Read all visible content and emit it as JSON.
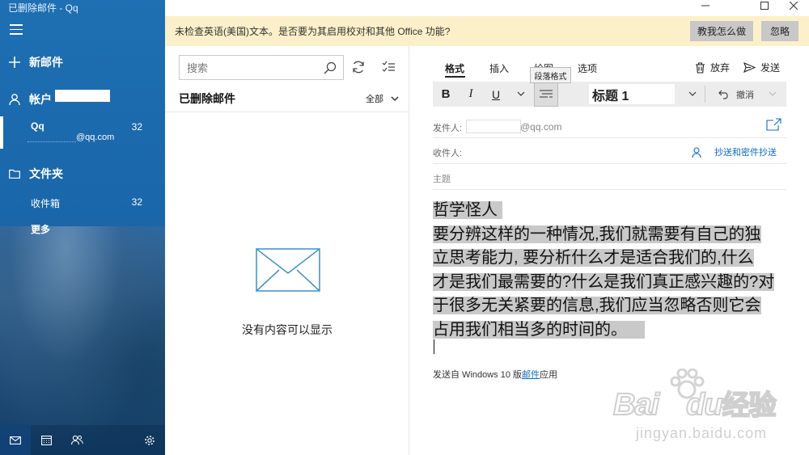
{
  "window": {
    "title": "已删除邮件 - Qq"
  },
  "sidebar": {
    "new_mail": "新邮件",
    "accounts_label": "帐户",
    "account": {
      "name": "Qq",
      "count": "32",
      "email_suffix": "@qq.com"
    },
    "folders_label": "文件夹",
    "inbox": {
      "label": "收件箱",
      "count": "32"
    },
    "more": "更多"
  },
  "infobar": {
    "message": "未检查英语(美国)文本。是否要为其启用校对和其他 Office 功能?",
    "teach_button": "教我怎么做",
    "ignore_button": "忽略"
  },
  "list": {
    "search_placeholder": "搜索",
    "folder_title": "已删除邮件",
    "filter_label": "全部",
    "empty_message": "没有内容可以显示"
  },
  "compose": {
    "tabs": [
      "格式",
      "插入",
      "绘图",
      "选项"
    ],
    "discard_label": "放弃",
    "send_label": "发送",
    "bold": "B",
    "italic": "I",
    "underline": "U",
    "style_value": "标题 1",
    "undo_label": "撤消",
    "tooltip": "段落格式",
    "from_label": "发件人:",
    "from_suffix": "@qq.com",
    "to_label": "收件人:",
    "cc_link": "抄送和密件抄送",
    "subject_placeholder": "主题",
    "body_heading": "哲学怪人",
    "body_lines": [
      "要分辨这样的一种情况,我们就需要有自己的独",
      "立思考能力, 要分析什么才是适合我们的,什么",
      "才是我们最需要的?什么是我们真正感兴趣的?对",
      "于很多无关紧要的信息,我们应当忽略否则它会",
      "占用我们相当多的时间的。"
    ],
    "signature_prefix": "发送自 Windows 10 版",
    "signature_link": "邮件",
    "signature_suffix": "应用"
  },
  "watermark": {
    "brand": "Bai",
    "brand_suffix": "du",
    "cn": "经验",
    "url": "jingyan.baidu.com"
  },
  "colors": {
    "sidebar_blue": "#1e6fb3",
    "infobar_bg": "#fbf0c9",
    "link": "#0a6cc7",
    "highlight": "#c9c9c9"
  }
}
